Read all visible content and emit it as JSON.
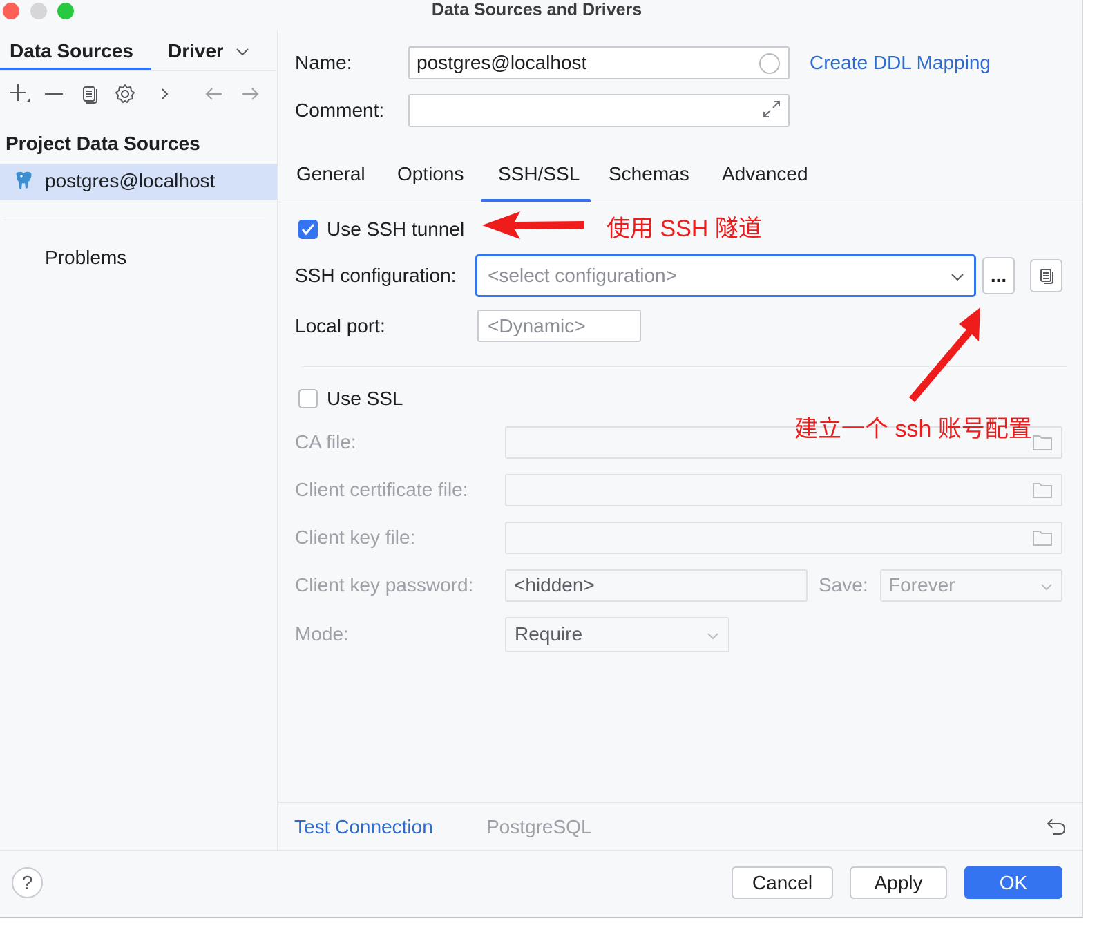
{
  "window": {
    "title": "Data Sources and Drivers"
  },
  "sidebar": {
    "tabs": [
      "Data Sources",
      "Driver"
    ],
    "section_title": "Project Data Sources",
    "items": [
      {
        "label": "postgres@localhost",
        "icon": "postgresql-elephant-icon"
      }
    ],
    "problems_label": "Problems"
  },
  "form": {
    "name_label": "Name:",
    "name_value": "postgres@localhost",
    "comment_label": "Comment:",
    "comment_value": "",
    "ddl_link": "Create DDL Mapping"
  },
  "tabs": [
    {
      "label": "General",
      "active": false
    },
    {
      "label": "Options",
      "active": false
    },
    {
      "label": "SSH/SSL",
      "active": true
    },
    {
      "label": "Schemas",
      "active": false
    },
    {
      "label": "Advanced",
      "active": false
    }
  ],
  "ssh": {
    "use_tunnel_label": "Use SSH tunnel",
    "use_tunnel_checked": true,
    "config_label": "SSH configuration:",
    "config_placeholder": "<select configuration>",
    "more_button": "...",
    "local_port_label": "Local port:",
    "local_port_placeholder": "<Dynamic>"
  },
  "ssl": {
    "use_ssl_label": "Use SSL",
    "use_ssl_checked": false,
    "ca_file_label": "CA file:",
    "client_cert_label": "Client certificate file:",
    "client_key_label": "Client key file:",
    "client_key_password_label": "Client key password:",
    "client_key_password_value": "<hidden>",
    "save_label": "Save:",
    "save_value": "Forever",
    "mode_label": "Mode:",
    "mode_value": "Require"
  },
  "bottom_bar": {
    "test_connection": "Test Connection",
    "driver_name": "PostgreSQL"
  },
  "footer": {
    "help": "?",
    "cancel": "Cancel",
    "apply": "Apply",
    "ok": "OK"
  },
  "annotations": {
    "tunnel_note": "使用 SSH 隧道",
    "config_note": "建立一个 ssh 账号配置"
  },
  "colors": {
    "accent": "#3574f0",
    "link": "#2e6bd1",
    "annotation": "#ef1c1c",
    "selection": "#d5e1f8"
  }
}
